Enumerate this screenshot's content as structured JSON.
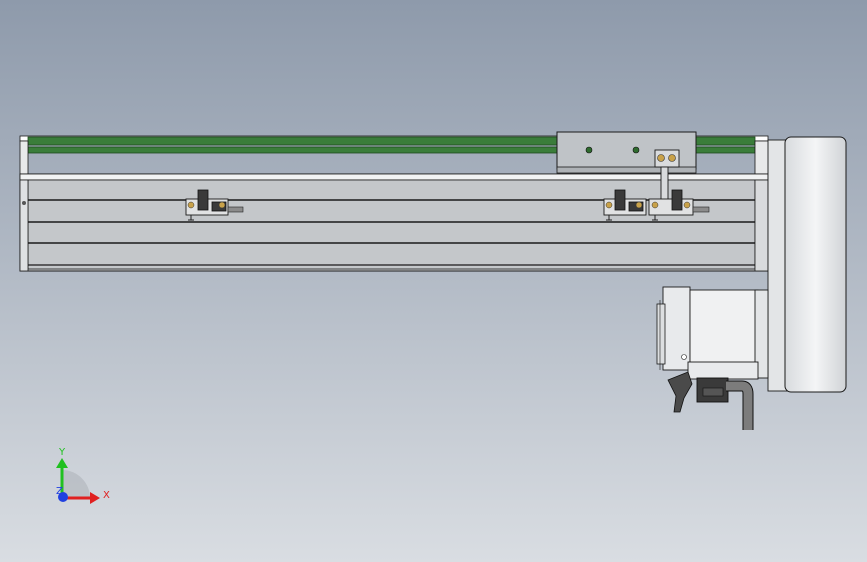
{
  "viewport": {
    "background_top": "#8e9aab",
    "background_bottom": "#d9dde2"
  },
  "colors": {
    "belt": "#3a7d3a",
    "belt_dark": "#1d4a1d",
    "profile": "#c9cccf",
    "profile_edge": "#1a1a1a",
    "slot": "#1a1a1a",
    "carriage": "#bfc3c7",
    "motor_housing": "#eceef0",
    "cable": "#7c7c7c",
    "sensor": "#3a3a3a",
    "brass": "#c9a24a"
  },
  "model": {
    "parts": [
      "belt",
      "aluminum-profile",
      "carriage",
      "limit-sensor-left",
      "limit-sensor-right",
      "limit-sensor-center",
      "sensor-dog",
      "motor-cover",
      "servo-motor",
      "motor-cable"
    ]
  },
  "triad": {
    "x_label": "X",
    "y_label": "Y",
    "z_label": "Z",
    "x_color": "#e02020",
    "y_color": "#20c020",
    "z_color": "#2040e0"
  }
}
